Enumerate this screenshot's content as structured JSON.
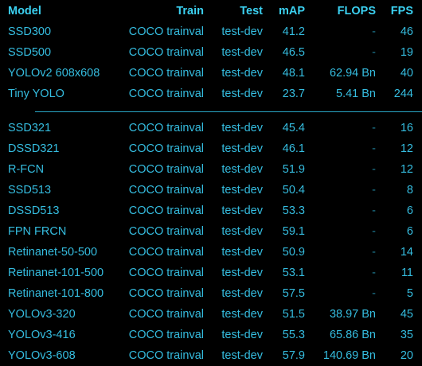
{
  "colors": {
    "background": "#000000",
    "header": "#3bd0f0",
    "text": "#35bde0",
    "muted": "#1f7f99",
    "divider": "#2aa8c8"
  },
  "chart_data": {
    "type": "table",
    "columns": [
      "Model",
      "Train",
      "Test",
      "mAP",
      "FLOPS",
      "FPS"
    ],
    "groups": [
      {
        "rows": [
          {
            "model": "SSD300",
            "train": "COCO trainval",
            "test": "test-dev",
            "map": "41.2",
            "flops": "-",
            "fps": "46"
          },
          {
            "model": "SSD500",
            "train": "COCO trainval",
            "test": "test-dev",
            "map": "46.5",
            "flops": "-",
            "fps": "19"
          },
          {
            "model": "YOLOv2 608x608",
            "train": "COCO trainval",
            "test": "test-dev",
            "map": "48.1",
            "flops": "62.94 Bn",
            "fps": "40"
          },
          {
            "model": "Tiny YOLO",
            "train": "COCO trainval",
            "test": "test-dev",
            "map": "23.7",
            "flops": "5.41 Bn",
            "fps": "244"
          }
        ]
      },
      {
        "rows": [
          {
            "model": "SSD321",
            "train": "COCO trainval",
            "test": "test-dev",
            "map": "45.4",
            "flops": "-",
            "fps": "16"
          },
          {
            "model": "DSSD321",
            "train": "COCO trainval",
            "test": "test-dev",
            "map": "46.1",
            "flops": "-",
            "fps": "12"
          },
          {
            "model": "R-FCN",
            "train": "COCO trainval",
            "test": "test-dev",
            "map": "51.9",
            "flops": "-",
            "fps": "12"
          },
          {
            "model": "SSD513",
            "train": "COCO trainval",
            "test": "test-dev",
            "map": "50.4",
            "flops": "-",
            "fps": "8"
          },
          {
            "model": "DSSD513",
            "train": "COCO trainval",
            "test": "test-dev",
            "map": "53.3",
            "flops": "-",
            "fps": "6"
          },
          {
            "model": "FPN FRCN",
            "train": "COCO trainval",
            "test": "test-dev",
            "map": "59.1",
            "flops": "-",
            "fps": "6"
          },
          {
            "model": "Retinanet-50-500",
            "train": "COCO trainval",
            "test": "test-dev",
            "map": "50.9",
            "flops": "-",
            "fps": "14"
          },
          {
            "model": "Retinanet-101-500",
            "train": "COCO trainval",
            "test": "test-dev",
            "map": "53.1",
            "flops": "-",
            "fps": "11"
          },
          {
            "model": "Retinanet-101-800",
            "train": "COCO trainval",
            "test": "test-dev",
            "map": "57.5",
            "flops": "-",
            "fps": "5"
          },
          {
            "model": "YOLOv3-320",
            "train": "COCO trainval",
            "test": "test-dev",
            "map": "51.5",
            "flops": "38.97 Bn",
            "fps": "45"
          },
          {
            "model": "YOLOv3-416",
            "train": "COCO trainval",
            "test": "test-dev",
            "map": "55.3",
            "flops": "65.86 Bn",
            "fps": "35"
          },
          {
            "model": "YOLOv3-608",
            "train": "COCO trainval",
            "test": "test-dev",
            "map": "57.9",
            "flops": "140.69 Bn",
            "fps": "20"
          }
        ]
      }
    ]
  }
}
